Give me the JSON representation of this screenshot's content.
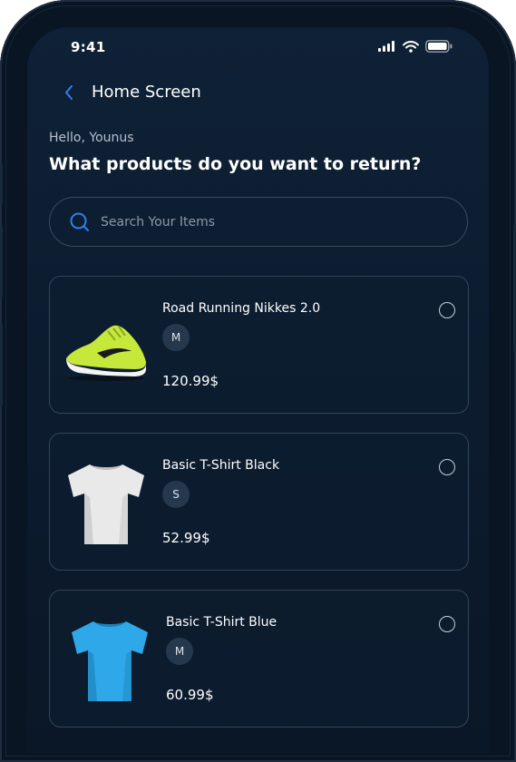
{
  "status_bar": {
    "time": "9:41"
  },
  "nav": {
    "title": "Home Screen"
  },
  "greeting": "Hello, Younus",
  "headline": "What products do you want to return?",
  "search": {
    "placeholder": "Search Your Items"
  },
  "products": [
    {
      "name": "Road Running Nikkes 2.0",
      "size": "M",
      "price": "120.99$",
      "image": "sneaker-image",
      "selected": false
    },
    {
      "name": "Basic T-Shirt Black",
      "size": "S",
      "price": "52.99$",
      "image": "white-tshirt-image",
      "selected": false
    },
    {
      "name": "Basic T-Shirt Blue",
      "size": "M",
      "price": "60.99$",
      "image": "blue-tshirt-image",
      "selected": false
    }
  ],
  "colors": {
    "background": "#0c1c2f",
    "accent": "#2f80ed",
    "card_border": "#33445a",
    "size_badge": "#25384e"
  },
  "icons": [
    "back-chevron-icon",
    "signal-icon",
    "wifi-icon",
    "battery-icon",
    "search-icon",
    "radio-icon"
  ]
}
